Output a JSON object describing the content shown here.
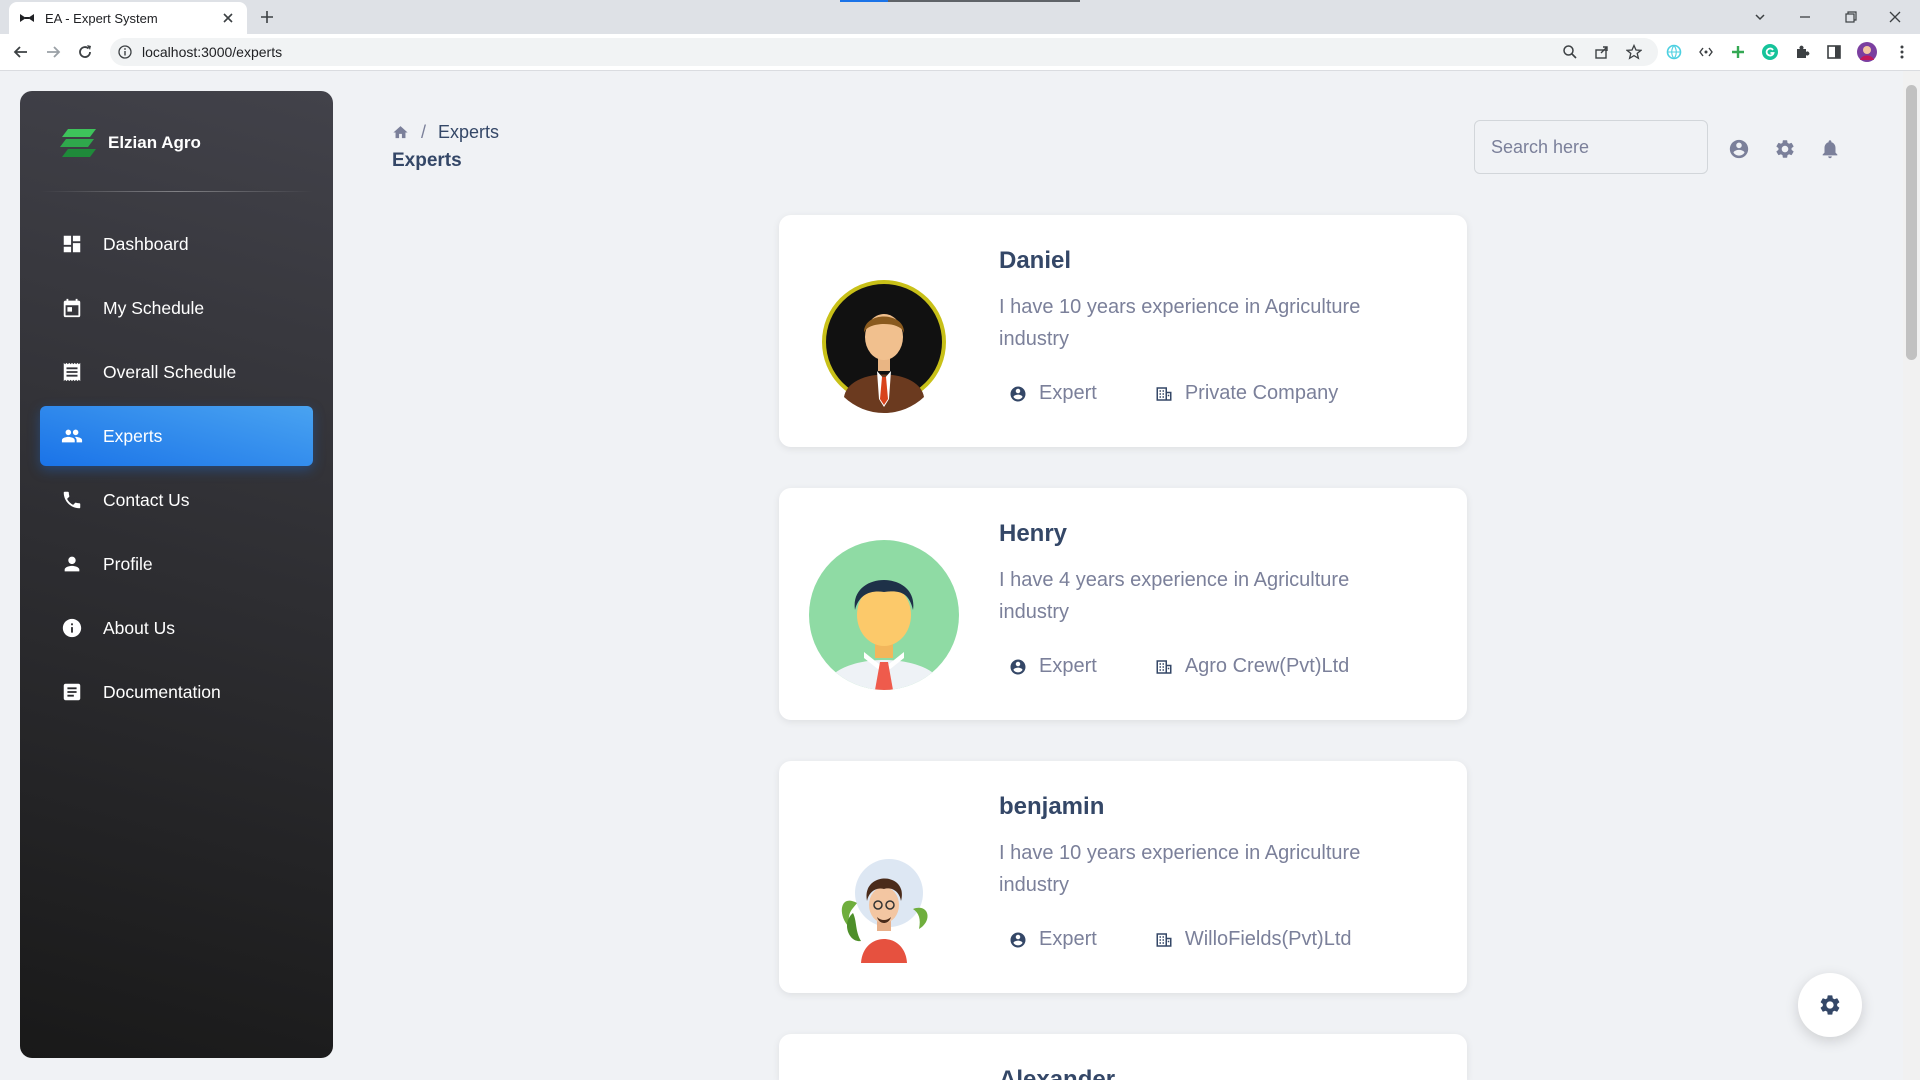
{
  "browser": {
    "tab_title": "EA - Expert System",
    "url": "localhost:3000/experts"
  },
  "sidebar": {
    "brand": "Elzian Agro",
    "items": [
      {
        "label": "Dashboard",
        "icon": "dashboard-icon",
        "active": false
      },
      {
        "label": "My Schedule",
        "icon": "calendar-icon",
        "active": false
      },
      {
        "label": "Overall Schedule",
        "icon": "receipt-icon",
        "active": false
      },
      {
        "label": "Experts",
        "icon": "group-icon",
        "active": true
      },
      {
        "label": "Contact Us",
        "icon": "phone-icon",
        "active": false
      },
      {
        "label": "Profile",
        "icon": "person-icon",
        "active": false
      },
      {
        "label": "About Us",
        "icon": "info-icon",
        "active": false
      },
      {
        "label": "Documentation",
        "icon": "document-icon",
        "active": false
      }
    ]
  },
  "header": {
    "breadcrumb_current": "Experts",
    "title": "Experts",
    "search_placeholder": "Search here"
  },
  "experts": [
    {
      "name": "Daniel",
      "description": "I have 10 years experience in Agriculture industry",
      "role": "Expert",
      "company": "Private Company"
    },
    {
      "name": "Henry",
      "description": "I have 4 years experience in Agriculture industry",
      "role": "Expert",
      "company": "Agro Crew(Pvt)Ltd"
    },
    {
      "name": "benjamin",
      "description": "I have 10 years experience in Agriculture industry",
      "role": "Expert",
      "company": "WilloFields(Pvt)Ltd"
    },
    {
      "name": "Alexander"
    }
  ],
  "colors": {
    "accent": "#1a73e8",
    "sidebar_bg": "#191919",
    "page_bg": "#f0f2f5"
  }
}
